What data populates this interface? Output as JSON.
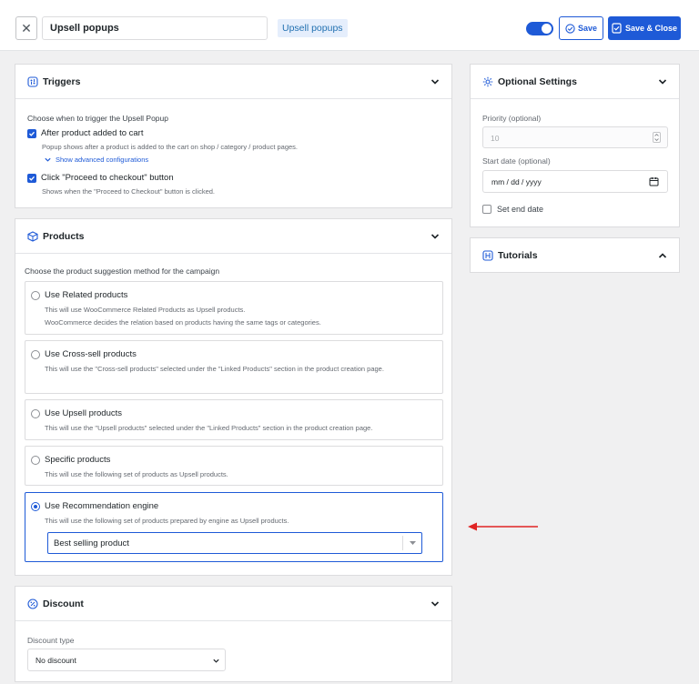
{
  "header": {
    "close_glyph": "✕",
    "campaign_name": "Upsell popups",
    "campaign_type": "Upsell popups",
    "toggle_enabled": true,
    "save_label": "Save",
    "save_close_label": "Save & Close"
  },
  "triggers": {
    "title": "Triggers",
    "prompt": "Choose when to trigger the Upsell Popup",
    "options": [
      {
        "label": "After product added to cart",
        "checked": true,
        "desc": "Popup shows after a product is added to the cart on shop / category / product pages.",
        "link": "Show advanced configurations"
      },
      {
        "label": "Click \"Proceed to checkout\" button",
        "checked": true,
        "desc": "Shows when the \"Proceed to Checkout\" button is clicked."
      }
    ]
  },
  "products": {
    "title": "Products",
    "prompt": "Choose the product suggestion method for the campaign",
    "options": [
      {
        "label": "Use Related products",
        "desc": "This will use WooCommerce Related Products as Upsell products.",
        "desc2": "WooCommerce decides the relation based on products having the same tags or categories.",
        "selected": false
      },
      {
        "label": "Use Cross-sell products",
        "desc": "This will use the \"Cross-sell products\" selected under the \"Linked Products\" section in the product creation page.",
        "selected": false
      },
      {
        "label": "Use Upsell products",
        "desc": "This will use the \"Upsell products\" selected under the \"Linked Products\" section in the product creation page.",
        "selected": false
      },
      {
        "label": "Specific products",
        "desc": "This will use the following set of products as Upsell products.",
        "selected": false
      },
      {
        "label": "Use Recommendation engine",
        "desc": "This will use the following set of products prepared by engine as Upsell products.",
        "selected": true
      }
    ],
    "engine_select_value": "Best selling product"
  },
  "discount": {
    "title": "Discount",
    "type_label": "Discount type",
    "type_value": "No discount"
  },
  "optional_settings": {
    "title": "Optional Settings",
    "priority_label": "Priority (optional)",
    "priority_placeholder": "10",
    "start_date_label": "Start date (optional)",
    "start_date_placeholder": "mm / dd / yyyy",
    "end_date_label": "Set end date",
    "end_date_checked": false
  },
  "tutorials": {
    "title": "Tutorials"
  },
  "colors": {
    "accent": "#1e5ad7",
    "annotation_arrow": "#e02424"
  }
}
